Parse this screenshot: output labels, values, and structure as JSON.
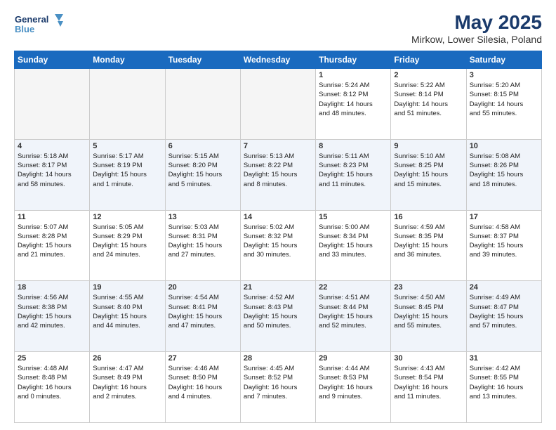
{
  "header": {
    "logo_line1": "General",
    "logo_line2": "Blue",
    "title": "May 2025",
    "subtitle": "Mirkow, Lower Silesia, Poland"
  },
  "days_of_week": [
    "Sunday",
    "Monday",
    "Tuesday",
    "Wednesday",
    "Thursday",
    "Friday",
    "Saturday"
  ],
  "weeks": [
    {
      "cells": [
        {
          "day": "",
          "empty": true
        },
        {
          "day": "",
          "empty": true
        },
        {
          "day": "",
          "empty": true
        },
        {
          "day": "",
          "empty": true
        },
        {
          "day": "1",
          "info": "Sunrise: 5:24 AM\nSunset: 8:12 PM\nDaylight: 14 hours\nand 48 minutes."
        },
        {
          "day": "2",
          "info": "Sunrise: 5:22 AM\nSunset: 8:14 PM\nDaylight: 14 hours\nand 51 minutes."
        },
        {
          "day": "3",
          "info": "Sunrise: 5:20 AM\nSunset: 8:15 PM\nDaylight: 14 hours\nand 55 minutes."
        }
      ]
    },
    {
      "cells": [
        {
          "day": "4",
          "info": "Sunrise: 5:18 AM\nSunset: 8:17 PM\nDaylight: 14 hours\nand 58 minutes."
        },
        {
          "day": "5",
          "info": "Sunrise: 5:17 AM\nSunset: 8:19 PM\nDaylight: 15 hours\nand 1 minute."
        },
        {
          "day": "6",
          "info": "Sunrise: 5:15 AM\nSunset: 8:20 PM\nDaylight: 15 hours\nand 5 minutes."
        },
        {
          "day": "7",
          "info": "Sunrise: 5:13 AM\nSunset: 8:22 PM\nDaylight: 15 hours\nand 8 minutes."
        },
        {
          "day": "8",
          "info": "Sunrise: 5:11 AM\nSunset: 8:23 PM\nDaylight: 15 hours\nand 11 minutes."
        },
        {
          "day": "9",
          "info": "Sunrise: 5:10 AM\nSunset: 8:25 PM\nDaylight: 15 hours\nand 15 minutes."
        },
        {
          "day": "10",
          "info": "Sunrise: 5:08 AM\nSunset: 8:26 PM\nDaylight: 15 hours\nand 18 minutes."
        }
      ]
    },
    {
      "cells": [
        {
          "day": "11",
          "info": "Sunrise: 5:07 AM\nSunset: 8:28 PM\nDaylight: 15 hours\nand 21 minutes."
        },
        {
          "day": "12",
          "info": "Sunrise: 5:05 AM\nSunset: 8:29 PM\nDaylight: 15 hours\nand 24 minutes."
        },
        {
          "day": "13",
          "info": "Sunrise: 5:03 AM\nSunset: 8:31 PM\nDaylight: 15 hours\nand 27 minutes."
        },
        {
          "day": "14",
          "info": "Sunrise: 5:02 AM\nSunset: 8:32 PM\nDaylight: 15 hours\nand 30 minutes."
        },
        {
          "day": "15",
          "info": "Sunrise: 5:00 AM\nSunset: 8:34 PM\nDaylight: 15 hours\nand 33 minutes."
        },
        {
          "day": "16",
          "info": "Sunrise: 4:59 AM\nSunset: 8:35 PM\nDaylight: 15 hours\nand 36 minutes."
        },
        {
          "day": "17",
          "info": "Sunrise: 4:58 AM\nSunset: 8:37 PM\nDaylight: 15 hours\nand 39 minutes."
        }
      ]
    },
    {
      "cells": [
        {
          "day": "18",
          "info": "Sunrise: 4:56 AM\nSunset: 8:38 PM\nDaylight: 15 hours\nand 42 minutes."
        },
        {
          "day": "19",
          "info": "Sunrise: 4:55 AM\nSunset: 8:40 PM\nDaylight: 15 hours\nand 44 minutes."
        },
        {
          "day": "20",
          "info": "Sunrise: 4:54 AM\nSunset: 8:41 PM\nDaylight: 15 hours\nand 47 minutes."
        },
        {
          "day": "21",
          "info": "Sunrise: 4:52 AM\nSunset: 8:43 PM\nDaylight: 15 hours\nand 50 minutes."
        },
        {
          "day": "22",
          "info": "Sunrise: 4:51 AM\nSunset: 8:44 PM\nDaylight: 15 hours\nand 52 minutes."
        },
        {
          "day": "23",
          "info": "Sunrise: 4:50 AM\nSunset: 8:45 PM\nDaylight: 15 hours\nand 55 minutes."
        },
        {
          "day": "24",
          "info": "Sunrise: 4:49 AM\nSunset: 8:47 PM\nDaylight: 15 hours\nand 57 minutes."
        }
      ]
    },
    {
      "cells": [
        {
          "day": "25",
          "info": "Sunrise: 4:48 AM\nSunset: 8:48 PM\nDaylight: 16 hours\nand 0 minutes."
        },
        {
          "day": "26",
          "info": "Sunrise: 4:47 AM\nSunset: 8:49 PM\nDaylight: 16 hours\nand 2 minutes."
        },
        {
          "day": "27",
          "info": "Sunrise: 4:46 AM\nSunset: 8:50 PM\nDaylight: 16 hours\nand 4 minutes."
        },
        {
          "day": "28",
          "info": "Sunrise: 4:45 AM\nSunset: 8:52 PM\nDaylight: 16 hours\nand 7 minutes."
        },
        {
          "day": "29",
          "info": "Sunrise: 4:44 AM\nSunset: 8:53 PM\nDaylight: 16 hours\nand 9 minutes."
        },
        {
          "day": "30",
          "info": "Sunrise: 4:43 AM\nSunset: 8:54 PM\nDaylight: 16 hours\nand 11 minutes."
        },
        {
          "day": "31",
          "info": "Sunrise: 4:42 AM\nSunset: 8:55 PM\nDaylight: 16 hours\nand 13 minutes."
        }
      ]
    }
  ]
}
